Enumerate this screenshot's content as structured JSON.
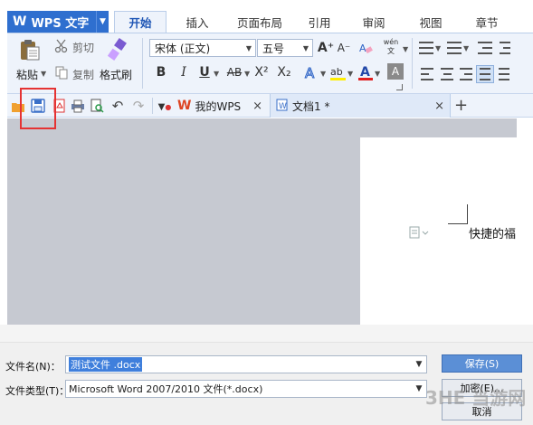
{
  "app": {
    "menu_label": "WPS 文字",
    "logo": "W"
  },
  "ribbon_tabs": [
    "开始",
    "插入",
    "页面布局",
    "引用",
    "审阅",
    "视图",
    "章节"
  ],
  "active_tab": "开始",
  "ribbon": {
    "paste_label": "粘贴",
    "cut_label": "剪切",
    "copy_label": "复制",
    "format_painter_label": "格式刷",
    "font_family": "宋体 (正文)",
    "font_size": "五号",
    "bold": "B",
    "italic": "I",
    "underline": "U",
    "strike": "AB",
    "superscript": "X²",
    "subscript": "X₂",
    "font_color_glyph": "A",
    "pinyin_glyph": "wén",
    "grow_font": "A⁺",
    "shrink_font": "A⁻"
  },
  "doc_tabs": [
    {
      "label": "我的WPS"
    },
    {
      "label": "文档1 *"
    }
  ],
  "new_tab_glyph": "+",
  "close_glyph": "×",
  "document": {
    "visible_text": "快捷的福"
  },
  "dialog": {
    "filename_label": "文件名(N)：",
    "filename_value": "测试文件 .docx",
    "filetype_label": "文件类型(T)：",
    "filetype_value": "Microsoft Word 2007/2010 文件(*.docx)",
    "save_button": "保存(S)",
    "encrypt_button": "加密(E)...",
    "cancel_button": "取消"
  },
  "watermark": "3HE 当游网",
  "colors": {
    "accent": "#2f6fcf",
    "ribbon_bg": "#eef3fb",
    "highlight_box": "#e53333",
    "workspace": "#c6c9d1"
  }
}
